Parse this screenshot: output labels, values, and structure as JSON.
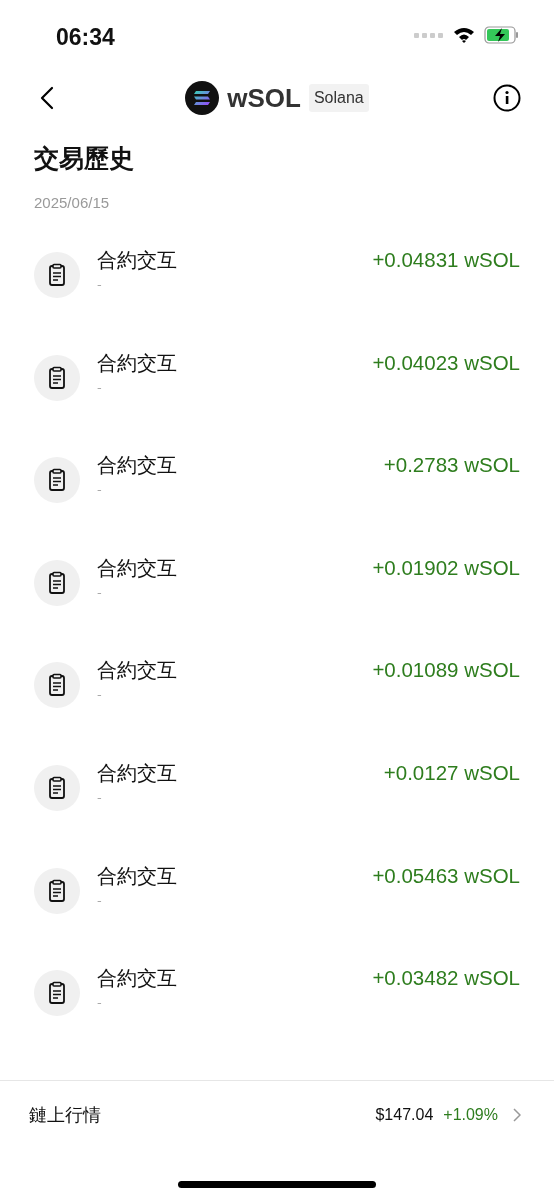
{
  "status_bar": {
    "time": "06:34"
  },
  "nav": {
    "token": "wSOL",
    "network": "Solana"
  },
  "title": "交易歷史",
  "date": "2025/06/15",
  "transactions": [
    {
      "type": "合約交互",
      "detail": "-",
      "amount": "+0.04831 wSOL"
    },
    {
      "type": "合約交互",
      "detail": "-",
      "amount": "+0.04023 wSOL"
    },
    {
      "type": "合約交互",
      "detail": "-",
      "amount": "+0.2783 wSOL"
    },
    {
      "type": "合約交互",
      "detail": "-",
      "amount": "+0.01902 wSOL"
    },
    {
      "type": "合約交互",
      "detail": "-",
      "amount": "+0.01089 wSOL"
    },
    {
      "type": "合約交互",
      "detail": "-",
      "amount": "+0.0127 wSOL"
    },
    {
      "type": "合約交互",
      "detail": "-",
      "amount": "+0.05463 wSOL"
    },
    {
      "type": "合約交互",
      "detail": "-",
      "amount": "+0.03482 wSOL"
    }
  ],
  "market": {
    "label": "鏈上行情",
    "price": "$147.04",
    "change": "+1.09%"
  }
}
